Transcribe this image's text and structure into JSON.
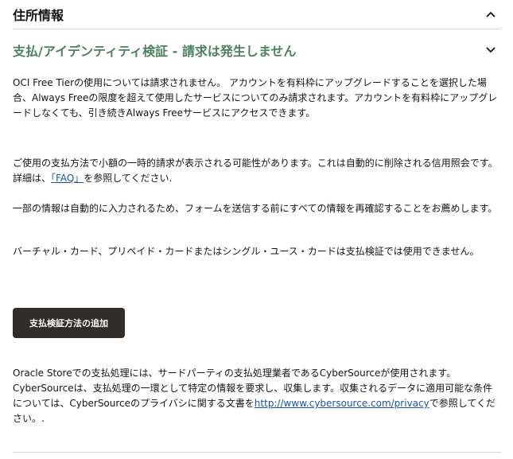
{
  "address_section": {
    "title": "住所情報",
    "toggle_icon": "chevron-up-icon"
  },
  "payment_section": {
    "title": "支払/アイデンティティ検証 - 請求は発生しません",
    "toggle_icon": "chevron-down-icon",
    "paragraph_1": "OCI Free Tierの使用については請求されません。 アカウントを有料枠にアップグレードすることを選択した場合、Always Freeの限度を超えて使用したサービスについてのみ請求されます。アカウントを有料枠にアップグレードしなくても、引き続きAlways Freeサービスにアクセスできます。",
    "paragraph_2_before": "ご使用の支払方法で小額の一時的請求が表示される可能性があります。これは自動的に削除される信用照会です。詳細は、",
    "faq_link": "「FAQ」",
    "paragraph_2_after": "を参照してください.",
    "paragraph_3": "一部の情報は自動的に入力されるため、フォームを送信する前にすべての情報を再確認することをお薦めします。",
    "paragraph_4": "バーチャル・カード、プリペイド・カードまたはシングル・ユース・カードは支払検証では使用できません。",
    "add_button_label": "支払検証方法の追加",
    "paragraph_5_before": "Oracle Storeでの支払処理には、サードパーティの支払処理業者であるCyberSourceが使用されます。CyberSourceは、支払処理の一環として特定の情報を要求し、収集します。収集されるデータに適用可能な条件については、CyberSourceのプライバシに関する文書を",
    "privacy_link": "http://www.cybersource.com/privacy",
    "paragraph_5_after": "で参照してください。."
  },
  "colors": {
    "heading_green": "#4c825c",
    "button_bg": "#312d2a",
    "link": "#1a56a8"
  }
}
